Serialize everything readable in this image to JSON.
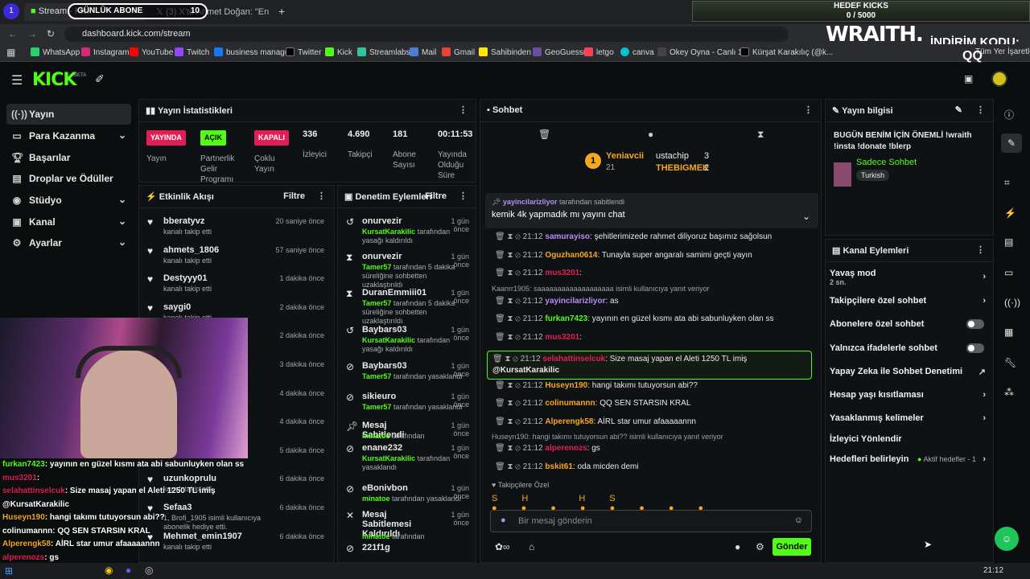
{
  "browser": {
    "tabs": [
      {
        "label": "Stream - Kick"
      },
      {
        "label": "(3) X'te Ahmet Doğan: \"En güz"
      }
    ],
    "new_tab": "+",
    "url": "dashboard.kick.com/stream",
    "bookmarks": [
      "WhatsApp",
      "Instagram",
      "YouTube",
      "Twitch",
      "business manager",
      "Twitter",
      "Kick",
      "Streamlabs",
      "Mail",
      "Gmail",
      "Sahibinden",
      "GeoGuessr",
      "letgo",
      "canva",
      "Okey Oyna - Canlı 1...",
      "Kürşat Karakılıç (@k..."
    ],
    "all_bookmarks": "Tüm Yer İşaretleri"
  },
  "overlay": {
    "daily_sub": "GÜNLÜK ABONE",
    "daily_sub_count": "10",
    "goal_title": "HEDEF KICKS",
    "goal_value": "0 / 5000",
    "sponsor": "WRAITH.",
    "discount": "İNDİRİM KODU:",
    "discount_code": "QQ"
  },
  "kick": {
    "logo": "KICK",
    "beta": "BETA"
  },
  "sidebar": [
    {
      "label": "Yayın",
      "icon": "stream-icon"
    },
    {
      "label": "Para Kazanma",
      "icon": "money-icon",
      "chev": true
    },
    {
      "label": "Başarılar",
      "icon": "trophy-icon"
    },
    {
      "label": "Droplar ve Ödüller",
      "icon": "gift-icon"
    },
    {
      "label": "Stüdyo",
      "icon": "studio-icon",
      "chev": true
    },
    {
      "label": "Kanal",
      "icon": "channel-icon",
      "chev": true
    },
    {
      "label": "Ayarlar",
      "icon": "gear-icon",
      "chev": true
    }
  ],
  "stats": {
    "title": "Yayın İstatistikleri",
    "items": [
      {
        "badge": "YAYINDA",
        "badge_color": "#e01f56",
        "label": "Yayın"
      },
      {
        "badge": "AÇIK",
        "badge_color": "#53fc18",
        "label": "Partnerlik Gelir Programı"
      },
      {
        "badge": "KAPALI",
        "badge_color": "#e01f56",
        "label": "Çoklu Yayın"
      },
      {
        "value": "336",
        "label": "İzleyici"
      },
      {
        "value": "4.690",
        "label": "Takipçi"
      },
      {
        "value": "181",
        "label": "Abone Sayısı"
      },
      {
        "value": "00:11:53",
        "label": "Yayında Olduğu Süre"
      }
    ]
  },
  "activity": {
    "title": "Etkinlik Akışı",
    "filter": "Filtre",
    "items": [
      {
        "name": "bberatyvz",
        "sub": "kanalı takip etti",
        "time": "20 saniye önce"
      },
      {
        "name": "ahmets_1806",
        "sub": "kanalı takip etti",
        "time": "57 saniye önce"
      },
      {
        "name": "Destyyy01",
        "sub": "kanalı takip etti",
        "time": "1 dakika önce"
      },
      {
        "name": "saygi0",
        "sub": "kanalı takip etti",
        "time": "2 dakika önce"
      },
      {
        "name": "",
        "sub": "",
        "time": "2 dakika önce"
      },
      {
        "name": "",
        "sub": "",
        "time": "3 dakika önce"
      },
      {
        "name": "",
        "sub": "",
        "time": "4 dakika önce"
      },
      {
        "name": "",
        "sub": "",
        "time": "4 dakika önce"
      },
      {
        "name": "",
        "sub": "",
        "time": "5 dakika önce"
      },
      {
        "name": "uzunkoprulu",
        "sub": "kanalı takip etti",
        "time": "6 dakika önce"
      },
      {
        "name": "Sefaa3",
        "sub": "1, Brofi_1905 isimli kullanıcıya abonelik hediye etti.",
        "time": "6 dakika önce"
      },
      {
        "name": "Mehmet_emin1907",
        "sub": "kanalı takip etti",
        "time": "6 dakika önce"
      }
    ]
  },
  "moderation": {
    "title": "Denetim Eylemleri",
    "filter": "Filtre",
    "items": [
      {
        "name": "onurvezir",
        "by": "KursatKarakilic",
        "rest": "tarafından yasağı kaldırıldı",
        "time": "1 gün önce",
        "icon": "undo-icon"
      },
      {
        "name": "onurvezir",
        "by": "Tamer57",
        "rest": "tarafından 5 dakika süreliğine sohbetten uzaklaştırıldı",
        "time": "1 gün önce",
        "icon": "hourglass-icon"
      },
      {
        "name": "DuranEmmiii01",
        "by": "Tamer57",
        "rest": "tarafından 5 dakika süreliğine sohbetten uzaklaştırıldı",
        "time": "1 gün önce",
        "icon": "hourglass-icon"
      },
      {
        "name": "Baybars03",
        "by": "KursatKarakilic",
        "rest": "tarafından yasağı kaldırıldı",
        "time": "1 gün önce",
        "icon": "undo-icon"
      },
      {
        "name": "Baybars03",
        "by": "Tamer57",
        "rest": "tarafından yasaklandı",
        "time": "1 gün önce",
        "icon": "ban-icon"
      },
      {
        "name": "sikieuro",
        "by": "Tamer57",
        "rest": "tarafından yasaklandı",
        "time": "1 gün önce",
        "icon": "ban-icon"
      },
      {
        "name": "Mesaj Sabitlendi",
        "by": "minatoe",
        "rest": "tarafından",
        "time": "1 gün önce",
        "icon": "pin-icon"
      },
      {
        "name": "enane232",
        "by": "KursatKarakilic",
        "rest": "tarafından yasaklandı",
        "time": "1 gün önce",
        "icon": "ban-icon"
      },
      {
        "name": "eBonivbon",
        "by": "minatoe",
        "rest": "tarafından yasaklandı",
        "time": "1 gün önce",
        "icon": "ban-icon"
      },
      {
        "name": "Mesaj Sabitlemesi Kaldırıldı",
        "by": "minatoe",
        "rest": "tarafından",
        "time": "1 gün önce",
        "icon": "unpin-icon"
      },
      {
        "name": "221f1g",
        "by": "",
        "rest": "",
        "time": "",
        "icon": "ban-icon"
      }
    ]
  },
  "chat": {
    "title": "Sohbet",
    "leaders": [
      {
        "rank": "1",
        "name": "Yeniavcii",
        "count": "21"
      },
      {
        "name": "ustachip",
        "count": "3"
      },
      {
        "name": "THEBIGMEK",
        "count": "2"
      }
    ],
    "pinned_by": "yayincilarizliyor",
    "pinned_by_rest": "tarafından sabitlendi",
    "pinned_text": "kemik 4k yapmadık mı yayını chat",
    "messages": [
      {
        "time": "21:12",
        "user": "samurayiso",
        "color": "#b48ef5",
        "text": ": şehitlerimizede rahmet diliyoruz başımız sağolsun"
      },
      {
        "time": "21:12",
        "user": "Oguzhan0614",
        "color": "#f5a623",
        "text": ": Tunayla super angaralı samimi geçti yayın"
      },
      {
        "time": "21:12",
        "user": "mus3201",
        "color": "#e01f56",
        "text": ": "
      },
      {
        "reply": "Kaanrr1905: saaaaaaaaaaaaaaaaaaa isimli kullanıcıya yanıt veriyor"
      },
      {
        "time": "21:12",
        "user": "yayincilarizliyor",
        "color": "#b48ef5",
        "text": ": as"
      },
      {
        "time": "21:12",
        "user": "furkan7423",
        "color": "#53fc18",
        "text": ": yayının en güzel kısmı ata abi sabunluyken olan ss"
      },
      {
        "time": "21:12",
        "user": "mus3201",
        "color": "#e01f56",
        "text": ": "
      },
      {
        "time": "21:12",
        "user": "selahattinselcuk",
        "color": "#e01f56",
        "text": ": Size masaj yapan el Aleti 1250 TL imiş",
        "mention": "@KursatKarakilic"
      },
      {
        "time": "21:12",
        "user": "Huseyn190",
        "color": "#f5a623",
        "text": ": hangi takımı tutuyorsun abi??"
      },
      {
        "time": "21:12",
        "user": "colinumannn",
        "color": "#f5a623",
        "text": ": QQ SEN STARSIN KRAL"
      },
      {
        "time": "21:12",
        "user": "Alperengk58",
        "color": "#f5a623",
        "text": ": AİRL star umur afaaaaannn"
      },
      {
        "reply": "Huseyn190: hangi takımı tutuyorsun abi?? isimli kullanıcıya yanıt veriyor"
      },
      {
        "time": "21:12",
        "user": "alperenozs",
        "color": "#e01f56",
        "text": ": gs"
      },
      {
        "time": "21:12",
        "user": "bskit61",
        "color": "#f5a623",
        "text": ": oda micden demi"
      }
    ],
    "mode": "Takipçilere Özel",
    "placeholder": "Bir mesaj gönderin",
    "send": "Gönder"
  },
  "info": {
    "title": "Yayın bilgisi",
    "stream_title": "BUGÜN BENİM İÇİN ÖNEMLİ !wraith !insta !donate !blerp",
    "category": "Sadece Sohbet",
    "tag": "Turkish"
  },
  "channel_actions": {
    "title": "Kanal Eylemleri",
    "slow_mode": "Yavaş mod",
    "slow_value": "2 sn.",
    "followers": "Takipçilere özel sohbet",
    "subs": "Abonelere özel sohbet",
    "emotes": "Yalnızca ifadelerle sohbet",
    "ai": "Yapay Zeka ile Sohbet Denetimi",
    "age": "Hesap yaşı kısıtlaması",
    "banned": "Yasaklanmış kelimeler",
    "redirect": "İzleyici Yönlendir",
    "goals": "Hedefleri belirleyin",
    "goals_status": "Aktif hedefler - 1"
  },
  "cam_chat": [
    {
      "user": "furkan7423",
      "color": "#53fc18",
      "text": ": yayının en güzel kısmı ata abi sabunluyken olan ss"
    },
    {
      "user": "mus3201",
      "color": "#e01f56",
      "text": ":"
    },
    {
      "user": "selahattinselcuk",
      "color": "#e01f56",
      "text": ": Size masaj yapan el Aleti 1250 TL imiş"
    },
    {
      "user": "",
      "color": "#fff",
      "text": "@KursatKarakilic"
    },
    {
      "user": "Huseyn190",
      "color": "#f5a623",
      "text": ": hangi takımı tutuyorsun abi??"
    },
    {
      "user": "colinumannn",
      "color": "#fff",
      "text": ": QQ SEN STARSIN KRAL"
    },
    {
      "user": "Alperengk58",
      "color": "#f5a623",
      "text": ": AİRL star umur afaaaaannn"
    },
    {
      "user": "alperenozs",
      "color": "#e01f56",
      "text": ": gs"
    },
    {
      "user": "bskit61",
      "color": "#fff",
      "text": ": oda micden demi"
    }
  ],
  "taskbar": {
    "clock": "21:12"
  }
}
